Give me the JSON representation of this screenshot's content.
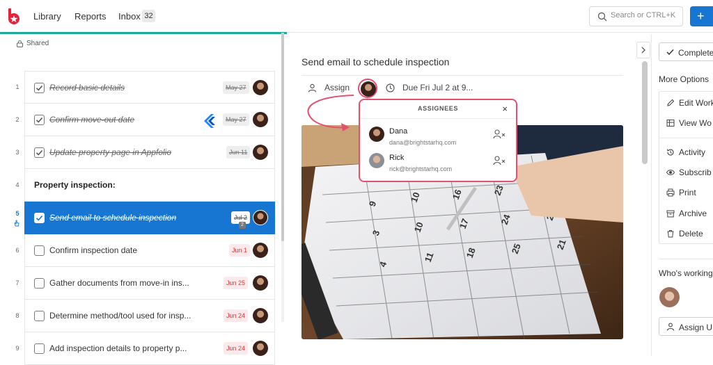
{
  "nav": {
    "library": "Library",
    "reports": "Reports",
    "inbox": "Inbox",
    "inbox_count": "32",
    "search_placeholder": "Search or CTRL+K",
    "new_button": "+"
  },
  "list": {
    "shared_label": "Shared",
    "rows": [
      {
        "num": "1",
        "title": "Record basic details",
        "date": "May 27",
        "done": true
      },
      {
        "num": "2",
        "title": "Confirm move-out date",
        "date": "May 27",
        "done": true
      },
      {
        "num": "3",
        "title": "Update property page in Appfolio",
        "date": "Jun 11",
        "done": true
      },
      {
        "num": "4",
        "title": "Property inspection:",
        "section": true
      },
      {
        "num": "5",
        "title": "Send email to schedule inspection",
        "date": "Jul 2",
        "done": true,
        "active": true,
        "assignee_count": "2"
      },
      {
        "num": "6",
        "title": "Confirm inspection date",
        "date": "Jun 1",
        "done": false
      },
      {
        "num": "7",
        "title": "Gather documents from move-in ins...",
        "date": "Jun 25",
        "done": false
      },
      {
        "num": "8",
        "title": "Determine method/tool used for insp...",
        "date": "Jun 24",
        "done": false
      },
      {
        "num": "9",
        "title": "Add inspection details to property p...",
        "date": "Jun 24",
        "done": false
      }
    ]
  },
  "detail": {
    "title": "Send email to schedule inspection",
    "assign_label": "Assign",
    "due_label": "Due Fri Jul 2 at 9..."
  },
  "assignees": {
    "heading": "ASSIGNEES",
    "close": "×",
    "people": [
      {
        "name": "Dana",
        "email": "dana@brightstarhq.com"
      },
      {
        "name": "Rick",
        "email": "rick@brightstarhq.com"
      }
    ]
  },
  "sidebar": {
    "complete": "Complete",
    "more_options": "More Options",
    "options": [
      {
        "label": "Edit Work",
        "icon": "pencil-icon"
      },
      {
        "label": "View Wo",
        "icon": "table-icon"
      },
      {
        "label": "Activity",
        "icon": "history-icon"
      },
      {
        "label": "Subscrib",
        "icon": "eye-icon"
      },
      {
        "label": "Print",
        "icon": "printer-icon"
      },
      {
        "label": "Archive",
        "icon": "archive-icon"
      },
      {
        "label": "Delete",
        "icon": "trash-icon"
      }
    ],
    "whos_working": "Who's working",
    "assign_me": "Assign U"
  },
  "colors": {
    "accent_blue": "#1776d1",
    "teal": "#1aa99b",
    "highlight_pink": "#e4516e",
    "due_red": "#d93a3a"
  }
}
